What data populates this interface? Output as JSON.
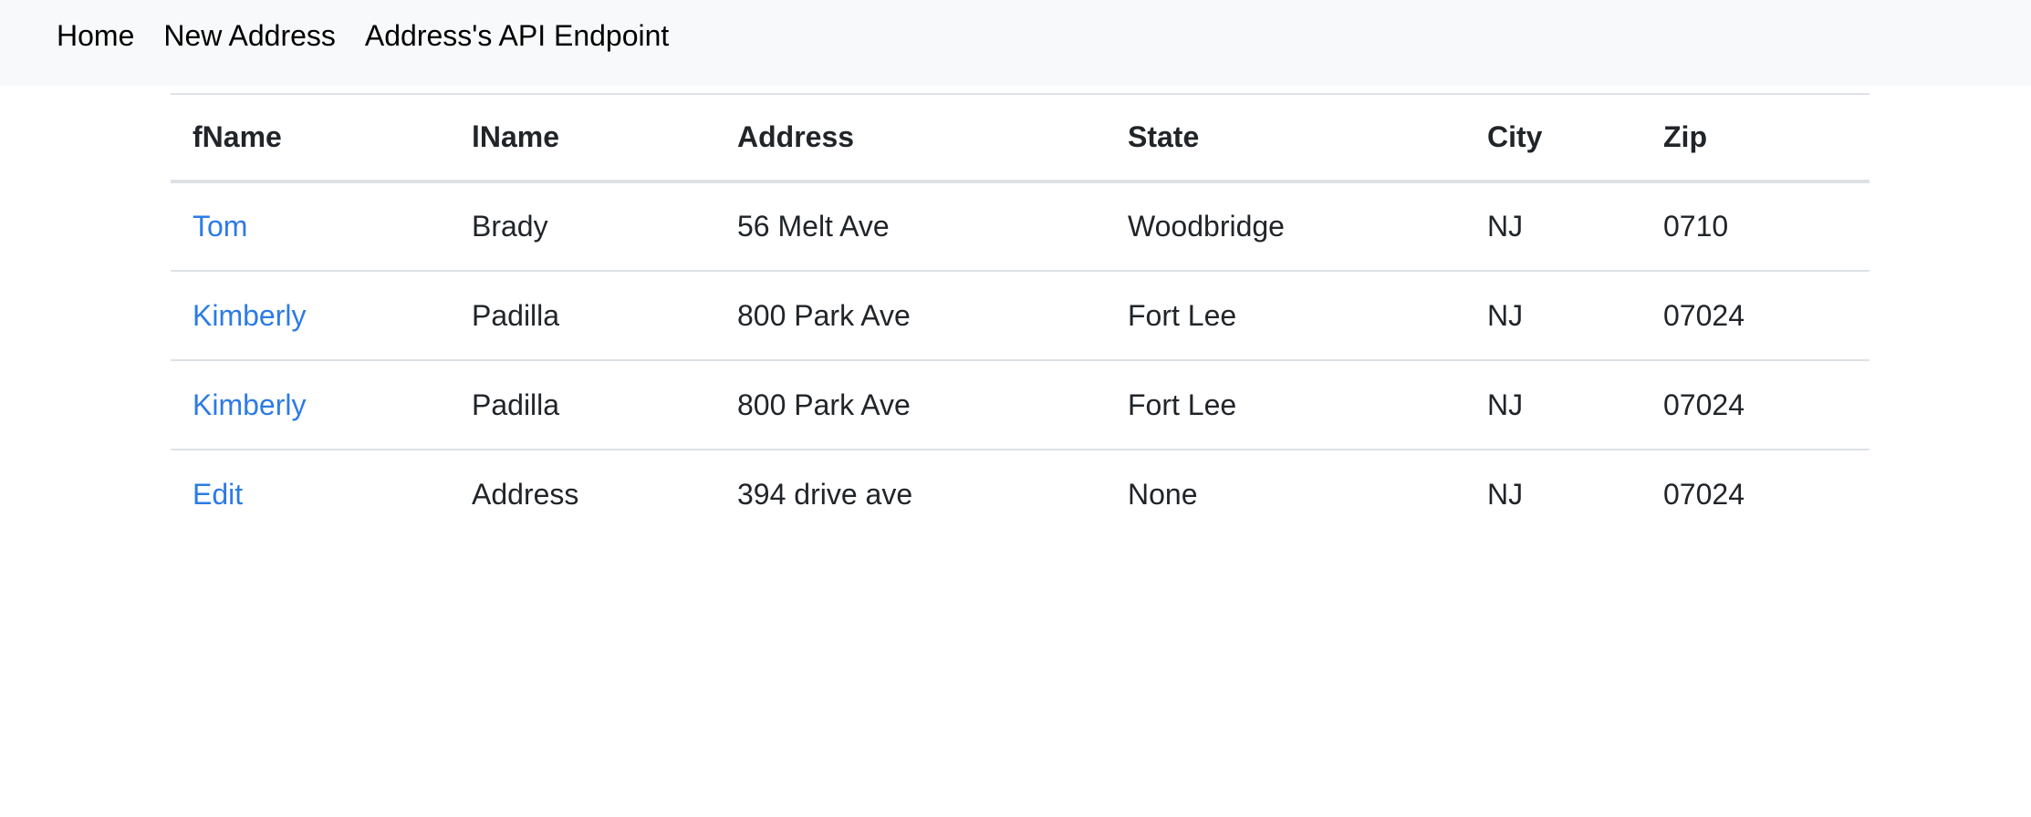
{
  "nav": {
    "items": [
      {
        "label": "Home"
      },
      {
        "label": "New Address"
      },
      {
        "label": "Address's API Endpoint"
      }
    ]
  },
  "table": {
    "headers": [
      "fName",
      "lName",
      "Address",
      "State",
      "City",
      "Zip"
    ],
    "rows": [
      {
        "fName": "Tom",
        "lName": "Brady",
        "address": "56 Melt Ave",
        "state": "Woodbridge",
        "city": "NJ",
        "zip": "0710"
      },
      {
        "fName": "Kimberly",
        "lName": "Padilla",
        "address": "800 Park Ave",
        "state": "Fort Lee",
        "city": "NJ",
        "zip": "07024"
      },
      {
        "fName": "Kimberly",
        "lName": "Padilla",
        "address": "800 Park Ave",
        "state": "Fort Lee",
        "city": "NJ",
        "zip": "07024"
      },
      {
        "fName": "Edit",
        "lName": "Address",
        "address": "394 drive ave",
        "state": "None",
        "city": "NJ",
        "zip": "07024"
      }
    ]
  },
  "colors": {
    "navbar_bg": "#f8f9fa",
    "link": "#2c7be5",
    "text": "#212529",
    "border": "#dee2e6"
  }
}
